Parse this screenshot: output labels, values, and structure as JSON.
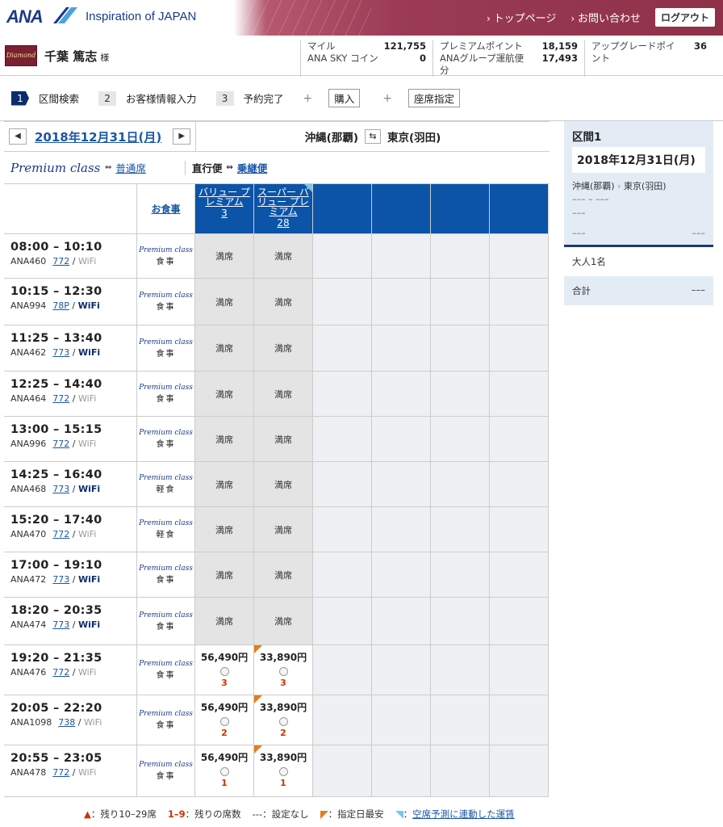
{
  "header": {
    "logo": "ANA",
    "tagline": "Inspiration of JAPAN",
    "nav": [
      "トップページ",
      "お問い合わせ"
    ],
    "logout": "ログアウト"
  },
  "user": {
    "badge": "Diamond",
    "name": "千葉 篤志",
    "suffix": "様",
    "miles_label": "マイル",
    "miles": "121,755",
    "coin_label": "ANA SKY コイン",
    "coin": "0",
    "premium_label": "プレミアムポイント",
    "premium": "18,159",
    "group_label": "ANAグループ運航便分",
    "group": "17,493",
    "upgrade_label": "アップグレードポイント",
    "upgrade": "36"
  },
  "steps": [
    {
      "num": "1",
      "label": "区間検索"
    },
    {
      "num": "2",
      "label": "お客様情報入力"
    },
    {
      "num": "3",
      "label": "予約完了"
    }
  ],
  "step_extra": {
    "plus": "+",
    "buy": "購入",
    "seat": "座席指定"
  },
  "search": {
    "prev": "◀",
    "next": "▶",
    "date": "2018年12月31日(月)",
    "from": "沖縄(那覇)",
    "to": "東京(羽田)",
    "swap": "⇆",
    "class_label": "Premium class",
    "switch": "⇔",
    "normal_label": "普通席",
    "direct_label": "直行便",
    "connect_label": "乗継便"
  },
  "columns": {
    "meal": "お食事",
    "fares": [
      {
        "name": "バリュー プレミアム",
        "num": "3"
      },
      {
        "name": "スーパー バリュー プレミアム",
        "num": "28"
      }
    ]
  },
  "flights": [
    {
      "time": "08:00 – 10:10",
      "no": "ANA460",
      "ac": "772",
      "wifi": "WiFi",
      "wifi_on": false,
      "meal": "食事",
      "f1": "満席",
      "f2": "満席"
    },
    {
      "time": "10:15 – 12:30",
      "no": "ANA994",
      "ac": "78P",
      "wifi": "WiFi",
      "wifi_on": true,
      "meal": "食事",
      "f1": "満席",
      "f2": "満席"
    },
    {
      "time": "11:25 – 13:40",
      "no": "ANA462",
      "ac": "773",
      "wifi": "WiFi",
      "wifi_on": true,
      "meal": "食事",
      "f1": "満席",
      "f2": "満席"
    },
    {
      "time": "12:25 – 14:40",
      "no": "ANA464",
      "ac": "772",
      "wifi": "WiFi",
      "wifi_on": false,
      "meal": "食事",
      "f1": "満席",
      "f2": "満席"
    },
    {
      "time": "13:00 – 15:15",
      "no": "ANA996",
      "ac": "772",
      "wifi": "WiFi",
      "wifi_on": false,
      "meal": "食事",
      "f1": "満席",
      "f2": "満席"
    },
    {
      "time": "14:25 – 16:40",
      "no": "ANA468",
      "ac": "773",
      "wifi": "WiFi",
      "wifi_on": true,
      "meal": "軽食",
      "f1": "満席",
      "f2": "満席"
    },
    {
      "time": "15:20 – 17:40",
      "no": "ANA470",
      "ac": "772",
      "wifi": "WiFi",
      "wifi_on": false,
      "meal": "軽食",
      "f1": "満席",
      "f2": "満席"
    },
    {
      "time": "17:00 – 19:10",
      "no": "ANA472",
      "ac": "773",
      "wifi": "WiFi",
      "wifi_on": true,
      "meal": "食事",
      "f1": "満席",
      "f2": "満席"
    },
    {
      "time": "18:20 – 20:35",
      "no": "ANA474",
      "ac": "773",
      "wifi": "WiFi",
      "wifi_on": true,
      "meal": "食事",
      "f1": "満席",
      "f2": "満席"
    },
    {
      "time": "19:20 – 21:35",
      "no": "ANA476",
      "ac": "772",
      "wifi": "WiFi",
      "wifi_on": false,
      "meal": "食事",
      "p1": "56,490円",
      "c1": "3",
      "p2": "33,890円",
      "c2": "3"
    },
    {
      "time": "20:05 – 22:20",
      "no": "ANA1098",
      "ac": "738",
      "wifi": "WiFi",
      "wifi_on": false,
      "meal": "食事",
      "p1": "56,490円",
      "c1": "2",
      "p2": "33,890円",
      "c2": "2"
    },
    {
      "time": "20:55 – 23:05",
      "no": "ANA478",
      "ac": "772",
      "wifi": "WiFi",
      "wifi_on": false,
      "meal": "食事",
      "p1": "56,490円",
      "c1": "1",
      "p2": "33,890円",
      "c2": "1"
    }
  ],
  "meal_brand": "Premium class",
  "legend": {
    "l1": "：残り10–29席",
    "l2_key": "1–9",
    "l2": "：残りの席数",
    "l3": "---：設定なし",
    "l4": "：指定日最安",
    "l5": "空席予測に連動した運賃"
  },
  "side": {
    "title": "区間1",
    "date": "2018年12月31日(月)",
    "from": "沖縄(那覇)",
    "sep": "›",
    "to": "東京(羽田)",
    "line1": "––– – –––",
    "line2": "–––",
    "price_l": "–––",
    "price_r": "–––",
    "adults": "大人1名",
    "total_label": "合計",
    "total": "–––"
  }
}
